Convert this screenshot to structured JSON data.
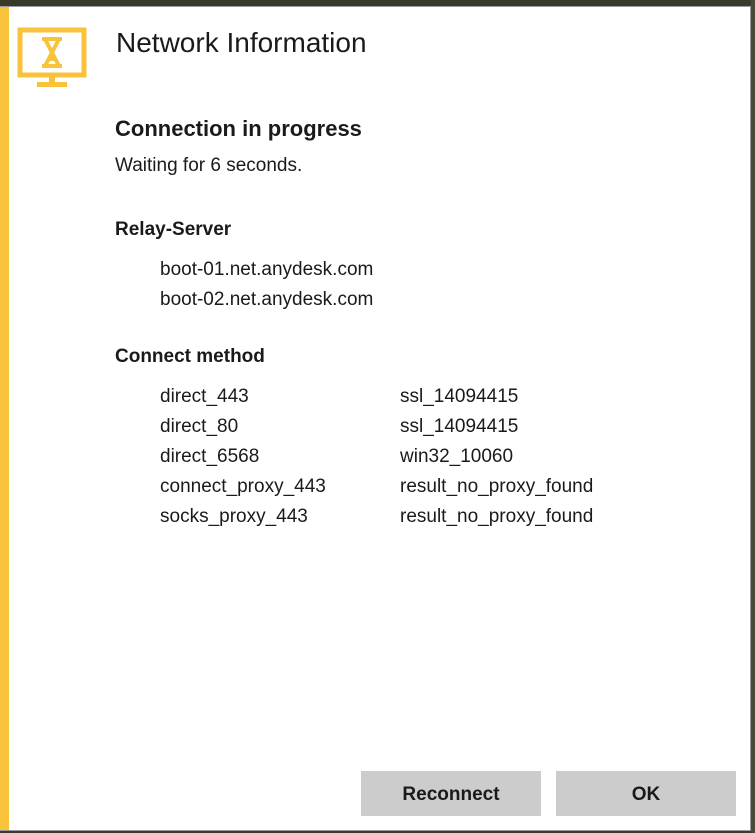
{
  "window": {
    "title": "Network Information",
    "accent_color": "#f8c33a",
    "icon": "hourglass-monitor-icon"
  },
  "status": {
    "heading": "Connection in progress",
    "text": "Waiting for 6 seconds."
  },
  "relay": {
    "heading": "Relay-Server",
    "servers": [
      "boot-01.net.anydesk.com",
      "boot-02.net.anydesk.com"
    ]
  },
  "connect_method": {
    "heading": "Connect method",
    "rows": [
      {
        "method": "direct_443",
        "result": "ssl_14094415"
      },
      {
        "method": "direct_80",
        "result": "ssl_14094415"
      },
      {
        "method": "direct_6568",
        "result": "win32_10060"
      },
      {
        "method": "connect_proxy_443",
        "result": "result_no_proxy_found"
      },
      {
        "method": "socks_proxy_443",
        "result": "result_no_proxy_found"
      }
    ]
  },
  "buttons": {
    "reconnect_label": "Reconnect",
    "ok_label": "OK"
  }
}
